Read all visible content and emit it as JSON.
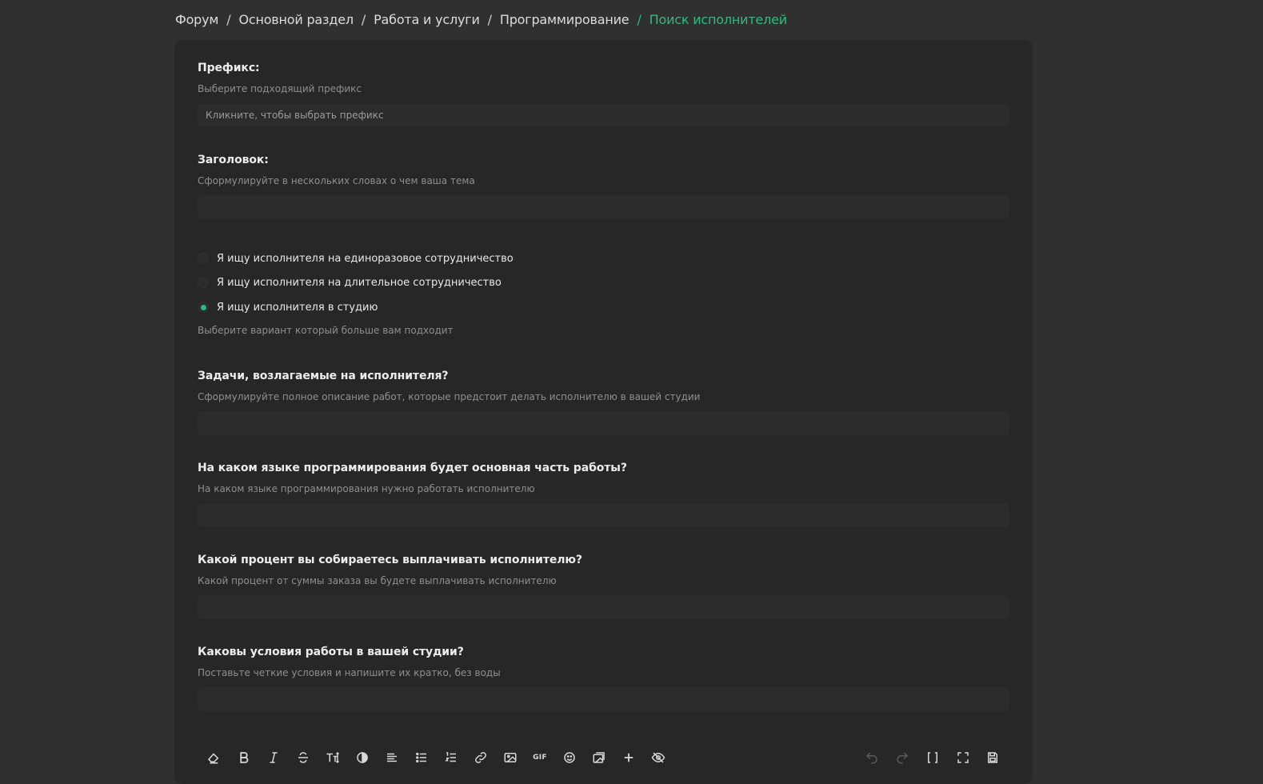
{
  "breadcrumb": {
    "items": [
      "Форум",
      "Основной раздел",
      "Работа и услуги",
      "Программирование"
    ],
    "current": "Поиск исполнителей",
    "separator": "/"
  },
  "form": {
    "prefix": {
      "label": "Префикс:",
      "hint": "Выберите подходящий префикс",
      "placeholder": "Кликните, чтобы выбрать префикс"
    },
    "title": {
      "label": "Заголовок:",
      "hint": "Сформулируйте в нескольких словах о чем ваша тема",
      "value": ""
    },
    "cooperation": {
      "options": [
        "Я ищу исполнителя на единоразовое сотрудничество",
        "Я ищу исполнителя на длительное сотрудничество",
        "Я ищу исполнителя в студию"
      ],
      "selected_index": 2,
      "hint": "Выберите вариант который больше вам подходит"
    },
    "tasks": {
      "label": "Задачи, возлагаемые на исполнителя?",
      "hint": "Сформулируйте полное описание работ, которые предстоит делать исполнителю в вашей студии",
      "value": ""
    },
    "language": {
      "label": "На каком языке программирования будет основная часть работы?",
      "hint": "На каком языке программирования нужно работать исполнителю",
      "value": ""
    },
    "percent": {
      "label": "Какой процент вы собираетесь выплачивать исполнителю?",
      "hint": "Какой процент от суммы заказа вы будете выплачивать исполнителю",
      "value": ""
    },
    "conditions": {
      "label": "Каковы условия работы в вашей студии?",
      "hint": "Поставьте четкие условия и напишите их кратко, без воды",
      "value": ""
    }
  },
  "toolbar": {
    "left_icons": [
      "eraser-icon",
      "bold-icon",
      "italic-icon",
      "strikethrough-icon",
      "text-size-icon",
      "contrast-icon",
      "align-left-icon",
      "bullet-list-icon",
      "numbered-list-icon",
      "link-icon",
      "image-icon",
      "gif-icon",
      "emoji-icon",
      "gallery-icon",
      "plus-icon",
      "hide-icon"
    ],
    "right_icons": [
      "undo-icon",
      "redo-icon",
      "brackets-icon",
      "fullscreen-icon",
      "save-draft-icon"
    ],
    "gif_label": "GIF"
  },
  "colors": {
    "accent": "#2bbd7e",
    "background": "#303030",
    "panel": "#272727"
  }
}
